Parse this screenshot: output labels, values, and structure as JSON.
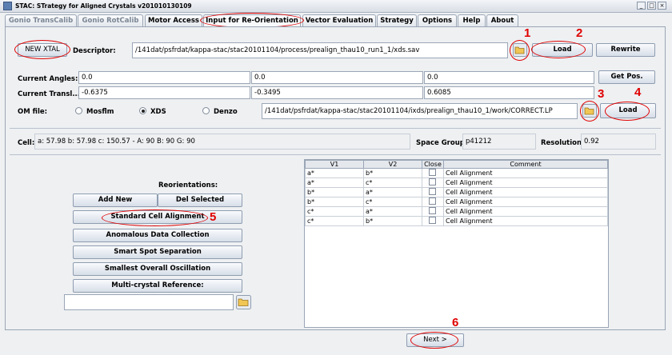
{
  "window": {
    "title": "STAC: STrategy for Aligned Crystals v201010130109"
  },
  "tabs": [
    "Gonio TransCalib",
    "Gonio RotCalib",
    "Motor Access",
    "Input for Re-Orientation",
    "Vector Evaluation",
    "Strategy",
    "Options",
    "Help",
    "About"
  ],
  "form": {
    "new_xtal": "NEW XTAL",
    "descriptor_label": "Descriptor:",
    "descriptor_value": "/141dat/psfrdat/kappa-stac/stac20101104/process/prealign_thau10_run1_1/xds.sav",
    "load_label": "Load",
    "rewrite_label": "Rewrite",
    "current_angles_label": "Current Angles:",
    "angles": [
      "0.0",
      "0.0",
      "0.0"
    ],
    "get_pos_label": "Get Pos.",
    "current_transl_label": "Current Transl...",
    "transl": [
      "-0.6375",
      "-0.3495",
      "0.6085"
    ],
    "om_file_label": "OM file:",
    "om_options": [
      "Mosflm",
      "XDS",
      "Denzo"
    ],
    "om_selected": "XDS",
    "om_path": "/141dat/psfrdat/kappa-stac/stac20101104/ixds/prealign_thau10_1/work/CORRECT.LP",
    "load2_label": "Load"
  },
  "cell": {
    "label": "Cell:",
    "value": "a: 57.98  b: 57.98  c: 150.57  -  A: 90  B: 90  G: 90",
    "space_group_label": "Space Group:",
    "space_group": "p41212",
    "resolution_label": "Resolution:",
    "resolution": "0.92"
  },
  "reorient": {
    "title": "Reorientations:",
    "add_new": "Add New",
    "del_selected": "Del Selected",
    "buttons": [
      "Standard Cell Alignment",
      "Anomalous Data Collection",
      "Smart Spot Separation",
      "Smallest Overall Oscillation",
      "Multi-crystal Reference:"
    ],
    "reference_value": ""
  },
  "table": {
    "headers": [
      "V1",
      "V2",
      "Close",
      "Comment"
    ],
    "rows": [
      [
        "a*",
        "b*",
        "Cell Alignment"
      ],
      [
        "a*",
        "c*",
        "Cell Alignment"
      ],
      [
        "b*",
        "a*",
        "Cell Alignment"
      ],
      [
        "b*",
        "c*",
        "Cell Alignment"
      ],
      [
        "c*",
        "a*",
        "Cell Alignment"
      ],
      [
        "c*",
        "b*",
        "Cell Alignment"
      ]
    ]
  },
  "footer": {
    "next_label": "Next >"
  },
  "annotations": [
    "1",
    "2",
    "3",
    "4",
    "5",
    "6"
  ]
}
